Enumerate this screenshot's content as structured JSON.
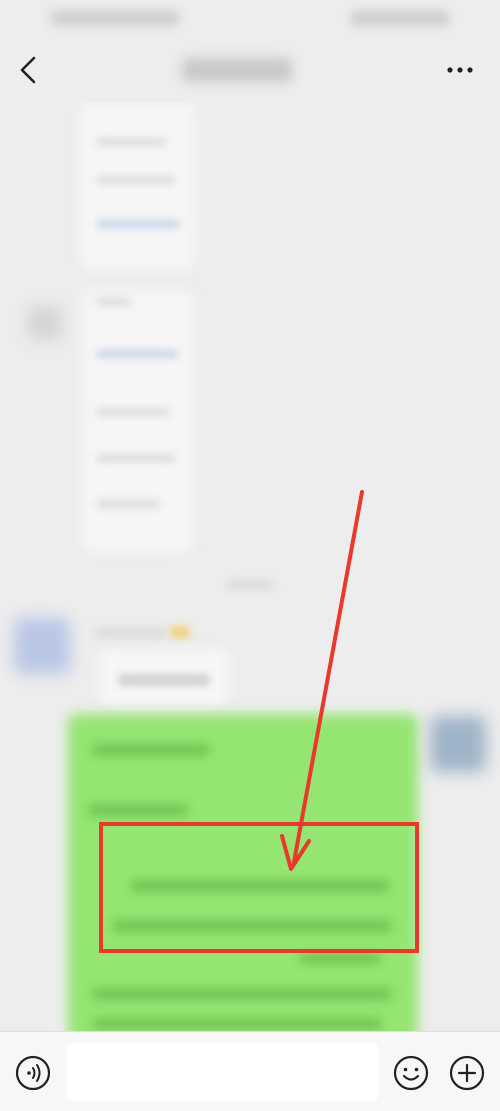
{
  "icons": {
    "back": "chevron-left-icon",
    "more": "ellipsis-icon",
    "voice": "voice-wave-icon",
    "emoji": "smiley-face-icon",
    "plus": "plus-circle-icon"
  },
  "colors": {
    "background": "#ededed",
    "outgoing_bubble": "#95e572",
    "annotation": "#e8392a",
    "input_bar": "#f7f7f7"
  },
  "input": {
    "value": "",
    "placeholder": ""
  }
}
